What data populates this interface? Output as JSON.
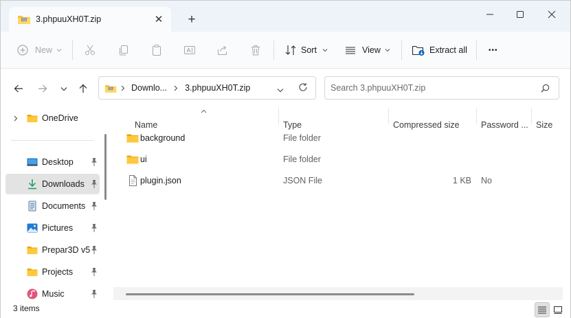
{
  "tab": {
    "title": "3.phpuuXH0T.zip",
    "close_glyph": "✕",
    "new_tab_glyph": "+"
  },
  "window_controls": {
    "minimize": "—",
    "maximize": "☐",
    "close": "✕"
  },
  "toolbar": {
    "new_label": "New",
    "sort_label": "Sort",
    "view_label": "View",
    "extract_label": "Extract all",
    "more_label": "•••"
  },
  "address": {
    "crumbs": [
      "Downlo...",
      "3.phpuuXH0T.zip"
    ]
  },
  "search": {
    "placeholder": "Search 3.phpuuXH0T.zip"
  },
  "sidebar": {
    "items": [
      {
        "label": "OneDrive",
        "icon": "folder-icon"
      },
      {
        "label": "Desktop",
        "icon": "desktop-icon",
        "pinned": true
      },
      {
        "label": "Downloads",
        "icon": "download-icon",
        "pinned": true,
        "selected": true
      },
      {
        "label": "Documents",
        "icon": "documents-icon",
        "pinned": true
      },
      {
        "label": "Pictures",
        "icon": "pictures-icon",
        "pinned": true
      },
      {
        "label": "Prepar3D v5",
        "icon": "folder-icon",
        "pinned": true
      },
      {
        "label": "Projects",
        "icon": "folder-icon",
        "pinned": true
      },
      {
        "label": "Music",
        "icon": "music-icon",
        "pinned": true
      }
    ]
  },
  "columns": {
    "name": "Name",
    "type": "Type",
    "compressed_size": "Compressed size",
    "password": "Password ...",
    "size": "Size"
  },
  "files": [
    {
      "name": "background",
      "type": "File folder",
      "compressed_size": "",
      "password": "",
      "icon": "folder-icon"
    },
    {
      "name": "ui",
      "type": "File folder",
      "compressed_size": "",
      "password": "",
      "icon": "folder-icon"
    },
    {
      "name": "plugin.json",
      "type": "JSON File",
      "compressed_size": "1 KB",
      "password": "No",
      "icon": "file-icon"
    }
  ],
  "status": {
    "item_count": "3 items"
  },
  "colors": {
    "accent": "#0067c0",
    "folder": "#f5c242",
    "selected_bg": "#e3e3e3"
  }
}
